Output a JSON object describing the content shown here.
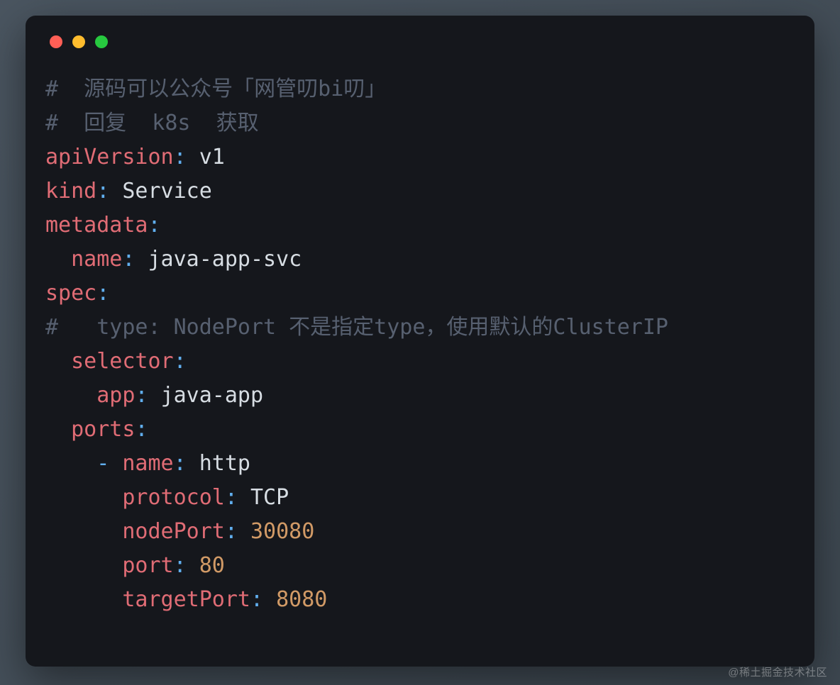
{
  "window": {
    "traffic_lights": [
      "red",
      "yellow",
      "green"
    ]
  },
  "code": {
    "comment1": "#  源码可以公众号「网管叨bi叨」",
    "comment2": "#  回复  k8s  获取",
    "apiVersion_key": "apiVersion",
    "apiVersion_val": "v1",
    "kind_key": "kind",
    "kind_val": "Service",
    "metadata_key": "metadata",
    "metadata_name_key": "name",
    "metadata_name_val": "java-app-svc",
    "spec_key": "spec",
    "comment3": "#   type: NodePort 不是指定type，使用默认的ClusterIP",
    "selector_key": "selector",
    "selector_app_key": "app",
    "selector_app_val": "java-app",
    "ports_key": "ports",
    "ports_dash": "-",
    "port_name_key": "name",
    "port_name_val": "http",
    "protocol_key": "protocol",
    "protocol_val": "TCP",
    "nodePort_key": "nodePort",
    "nodePort_val": "30080",
    "port_key": "port",
    "port_val": "80",
    "targetPort_key": "targetPort",
    "targetPort_val": "8080",
    "colon": ":"
  },
  "watermark": "@稀土掘金技术社区"
}
